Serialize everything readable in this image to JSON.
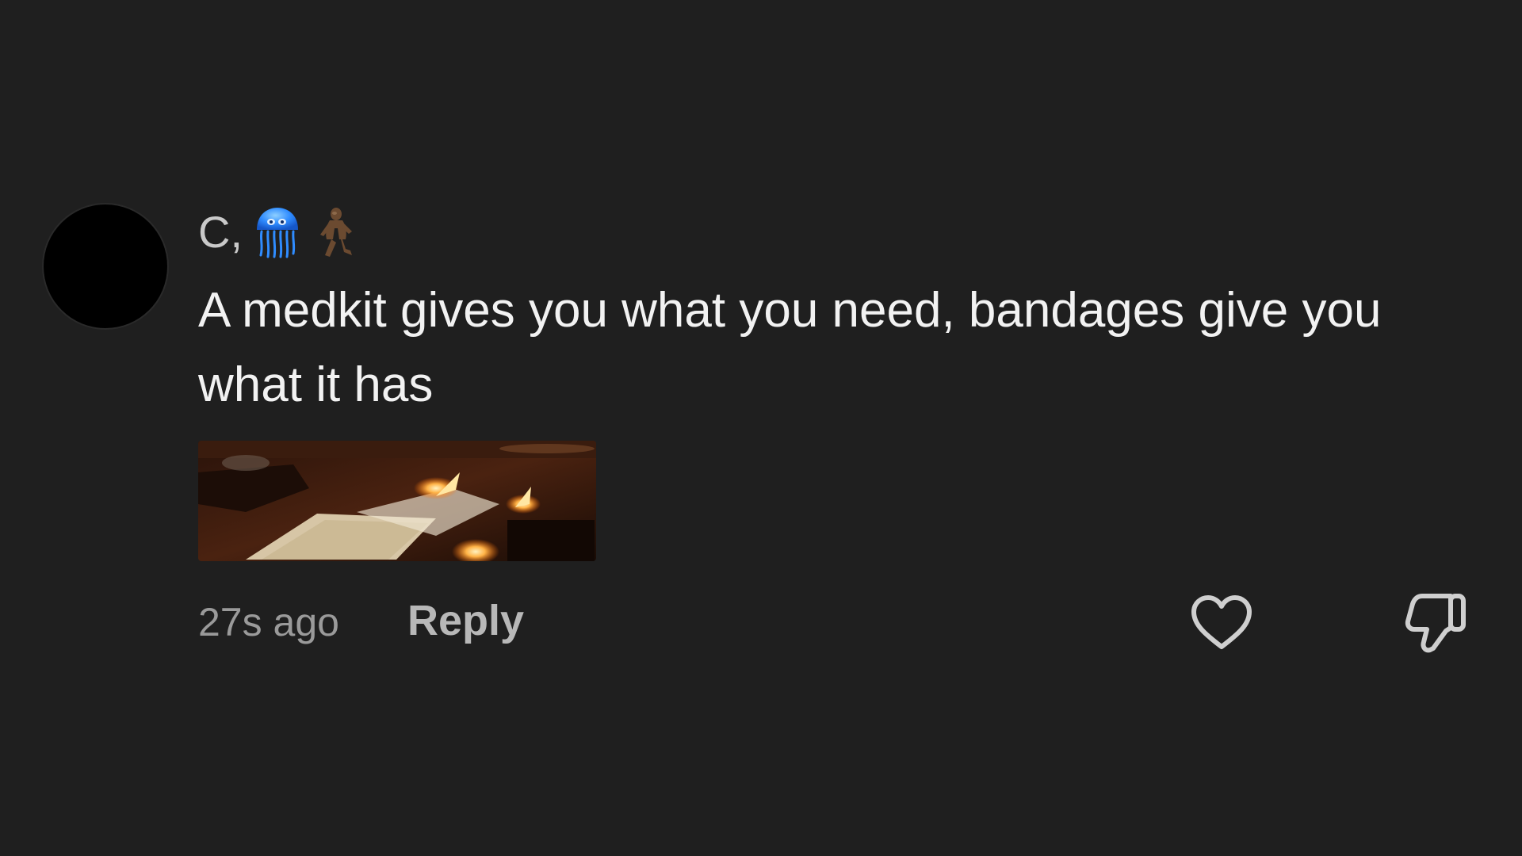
{
  "comment": {
    "username": "C,",
    "username_emojis": [
      "jellyfish-emoji",
      "bigfoot-emoji"
    ],
    "text": "A medkit gives you what you need, bandages give you what it has",
    "attachment": "gif-thumbnail",
    "timestamp": "27s ago",
    "reply_label": "Reply",
    "like_icon": "heart-icon",
    "dislike_icon": "thumbs-down-icon"
  },
  "colors": {
    "background": "#1f1f1f",
    "text": "#f2f2f2",
    "muted": "#9a9a9a",
    "accent_emoji": "#2f8cff"
  }
}
